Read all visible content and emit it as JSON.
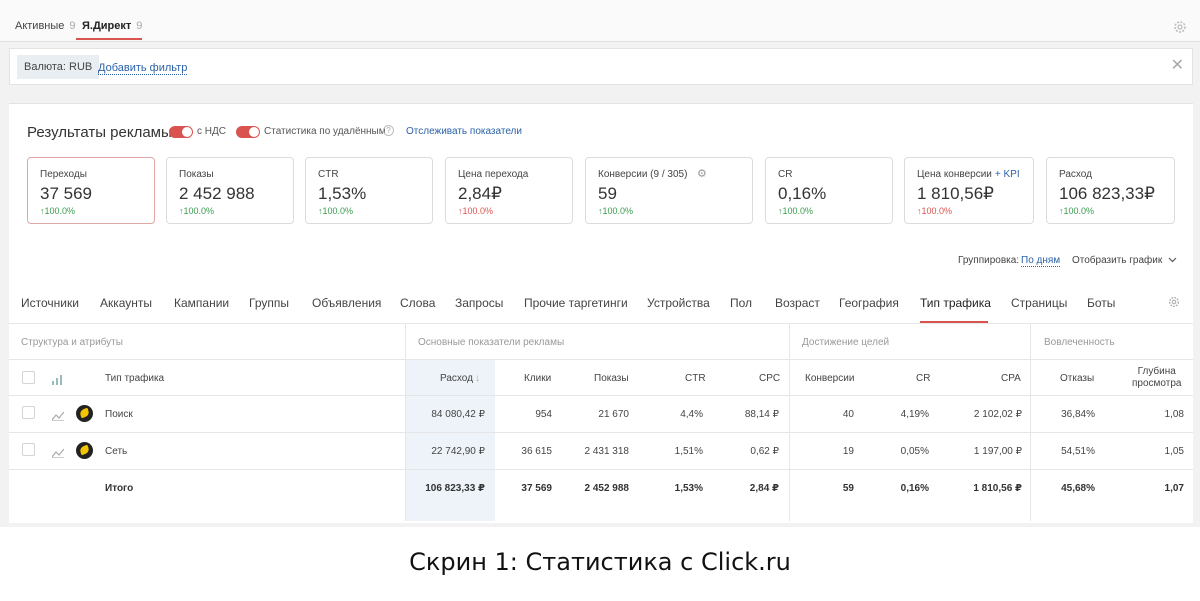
{
  "top_tabs": [
    {
      "label": "Активные",
      "count": "9"
    },
    {
      "label": "Я.Директ",
      "count": "9"
    }
  ],
  "filter": {
    "currency": "Валюта: RUB",
    "add_filter": "Добавить фильтр"
  },
  "results": {
    "title": "Результаты рекламы",
    "toggle_vat": "с НДС",
    "toggle_deleted": "Статистика по удалённым",
    "track_link": "Отслеживать показатели"
  },
  "cards": [
    {
      "label": "Переходы",
      "value": "37 569",
      "change": "↑100.0%",
      "trend": "up"
    },
    {
      "label": "Показы",
      "value": "2 452 988",
      "change": "↑100.0%",
      "trend": "up"
    },
    {
      "label": "CTR",
      "value": "1,53%",
      "change": "↑100.0%",
      "trend": "up"
    },
    {
      "label": "Цена перехода",
      "value": "2,84₽",
      "change": "↑100.0%",
      "trend": "down"
    },
    {
      "label": "Конверсии (9 / 305)",
      "value": "59",
      "change": "↑100.0%",
      "trend": "up"
    },
    {
      "label": "CR",
      "value": "0,16%",
      "change": "↑100.0%",
      "trend": "up"
    },
    {
      "label": "Цена конверсии",
      "kpi": "+ KPI",
      "value": "1 810,56₽",
      "change": "↑100.0%",
      "trend": "down"
    },
    {
      "label": "Расход",
      "value": "106 823,33₽",
      "change": "↑100.0%",
      "trend": "up"
    }
  ],
  "grouping": {
    "label": "Группировка:",
    "value": "По дням",
    "show_chart": "Отобразить график"
  },
  "dim_tabs": [
    "Источники",
    "Аккаунты",
    "Кампании",
    "Группы",
    "Объявления",
    "Слова",
    "Запросы",
    "Прочие таргетинги",
    "Устройства",
    "Пол",
    "Возраст",
    "География",
    "Тип трафика",
    "Страницы",
    "Боты"
  ],
  "table": {
    "groups": [
      "Структура и атрибуты",
      "Основные показатели рекламы",
      "Достижение целей",
      "Вовлеченность"
    ],
    "headers": {
      "type": "Тип трафика",
      "spend": "Расход",
      "sort_arrow": "↓",
      "clicks": "Клики",
      "impressions": "Показы",
      "ctr": "CTR",
      "cpc": "CPC",
      "conversions": "Конверсии",
      "cr": "CR",
      "cpa": "CPA",
      "bounces": "Отказы",
      "depth_line1": "Глубина",
      "depth_line2": "просмотра"
    },
    "rows": [
      {
        "name": "Поиск",
        "spend": "84 080,42 ₽",
        "clicks": "954",
        "impressions": "21 670",
        "ctr": "4,4%",
        "cpc": "88,14 ₽",
        "conversions": "40",
        "cr": "4,19%",
        "cpa": "2 102,02 ₽",
        "bounces": "36,84%",
        "depth": "1,08"
      },
      {
        "name": "Сеть",
        "spend": "22 742,90 ₽",
        "clicks": "36 615",
        "impressions": "2 431 318",
        "ctr": "1,51%",
        "cpc": "0,62 ₽",
        "conversions": "19",
        "cr": "0,05%",
        "cpa": "1 197,00 ₽",
        "bounces": "54,51%",
        "depth": "1,05"
      }
    ],
    "total": {
      "name": "Итого",
      "spend": "106 823,33 ₽",
      "clicks": "37 569",
      "impressions": "2 452 988",
      "ctr": "1,53%",
      "cpc": "2,84 ₽",
      "conversions": "59",
      "cr": "0,16%",
      "cpa": "1 810,56 ₽",
      "bounces": "45,68%",
      "depth": "1,07"
    }
  },
  "caption": "Скрин 1: Статистика с Click.ru",
  "colors": {
    "accent": "#d9534f",
    "link": "#2b62a8",
    "up": "#3a9a4c",
    "down": "#d9534f"
  }
}
